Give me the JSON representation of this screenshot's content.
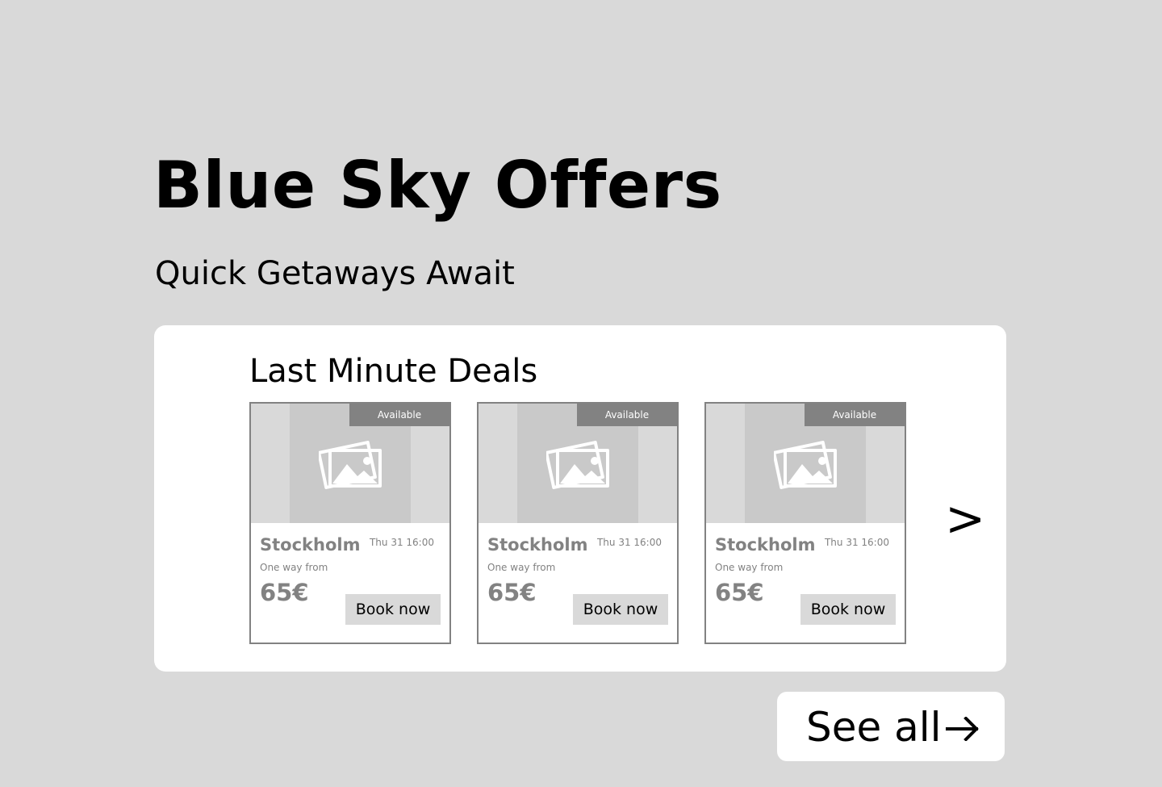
{
  "header": {
    "title": "Blue Sky Offers",
    "subtitle": "Quick Getaways Await"
  },
  "deals": {
    "section_title": "Last Minute Deals",
    "next_symbol": ">",
    "cards": [
      {
        "badge": "Available",
        "image_icon": "image-placeholder-icon",
        "city": "Stockholm",
        "date": "Thu 31 16:00",
        "fare_label": "One way from",
        "price": "65€",
        "button_label": "Book now"
      },
      {
        "badge": "Available",
        "image_icon": "image-placeholder-icon",
        "city": "Stockholm",
        "date": "Thu 31 16:00",
        "fare_label": "One way from",
        "price": "65€",
        "button_label": "Book now"
      },
      {
        "badge": "Available",
        "image_icon": "image-placeholder-icon",
        "city": "Stockholm",
        "date": "Thu 31 16:00",
        "fare_label": "One way from",
        "price": "65€",
        "button_label": "Book now"
      }
    ]
  },
  "see_all": {
    "label": "See all",
    "icon": "arrow-right-icon"
  },
  "colors": {
    "background": "#d9d9d9",
    "panel": "#ffffff",
    "card_border": "#828282",
    "badge": "#828282",
    "muted_text": "#828282",
    "image_placeholder": "#c9c9c9"
  }
}
